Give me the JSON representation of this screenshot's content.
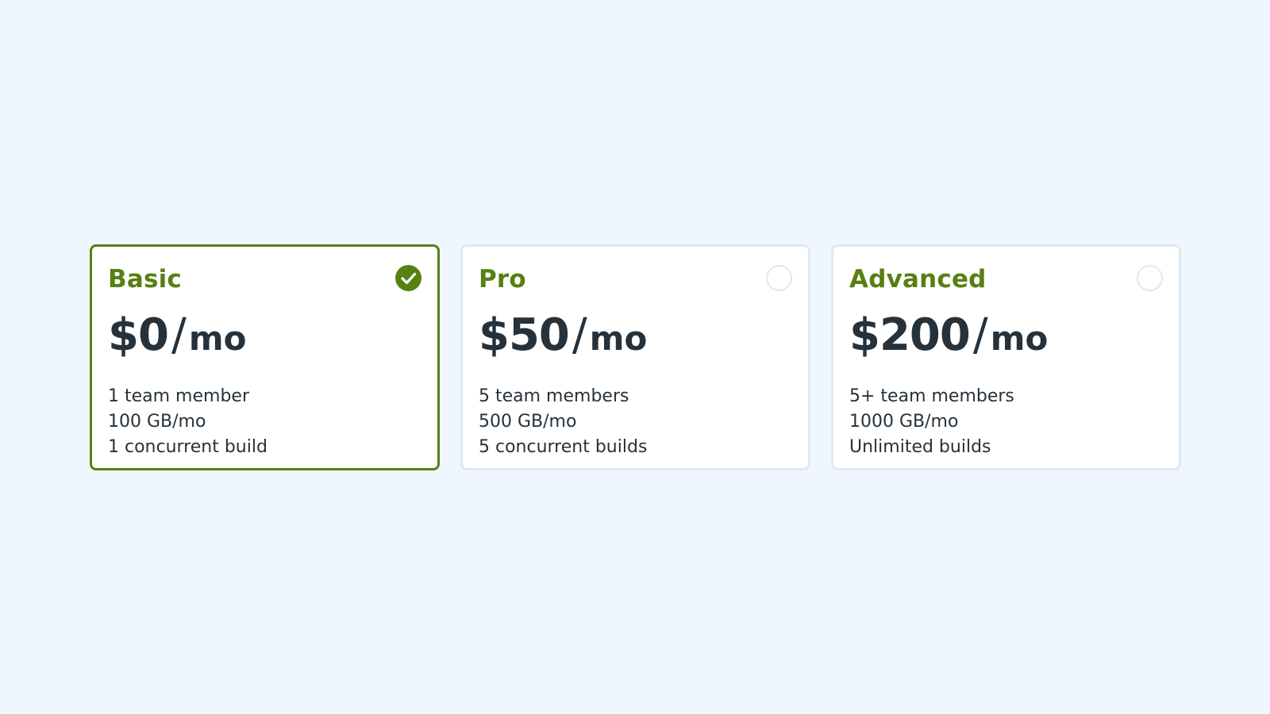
{
  "plans": [
    {
      "name": "Basic",
      "price": "$0",
      "separator": "/",
      "unit": "mo",
      "features": [
        "1 team member",
        "100 GB/mo",
        "1 concurrent build"
      ],
      "selected": true
    },
    {
      "name": "Pro",
      "price": "$50",
      "separator": "/",
      "unit": "mo",
      "features": [
        "5 team members",
        "500 GB/mo",
        "5 concurrent builds"
      ],
      "selected": false
    },
    {
      "name": "Advanced",
      "price": "$200",
      "separator": "/",
      "unit": "mo",
      "features": [
        "5+ team members",
        "1000 GB/mo",
        "Unlimited builds"
      ],
      "selected": false
    }
  ],
  "colors": {
    "background": "#eff6fe",
    "accent": "#568011",
    "text": "#26323b",
    "border": "#dfe8f3"
  },
  "icons": {
    "selected": "check-circle-icon",
    "unselected": "radio-circle-icon"
  }
}
